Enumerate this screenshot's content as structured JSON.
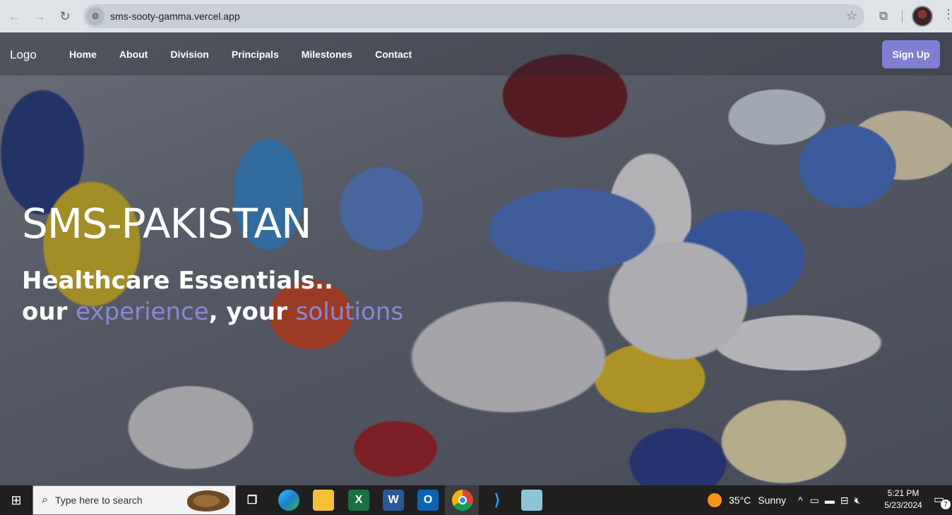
{
  "browser": {
    "url": "sms-sooty-gamma.vercel.app",
    "back_icon": "←",
    "forward_icon": "→",
    "reload_icon": "↻"
  },
  "site": {
    "logo": "Logo",
    "nav": [
      "Home",
      "About",
      "Division",
      "Principals",
      "Milestones",
      "Contact"
    ],
    "signup": "Sign Up",
    "accent_color": "#7f7fd3"
  },
  "hero": {
    "title": "SMS-PAKISTAN",
    "line2": "Healthcare Essentials..",
    "line3_a": "our ",
    "line3_b": "experience",
    "line3_c": ", your ",
    "line3_d": "solutions"
  },
  "taskbar": {
    "search_placeholder": "Type here to search",
    "weather_temp": "35°C",
    "weather_text": "Sunny",
    "time": "5:21 PM",
    "date": "5/23/2024",
    "notification_count": "7"
  }
}
